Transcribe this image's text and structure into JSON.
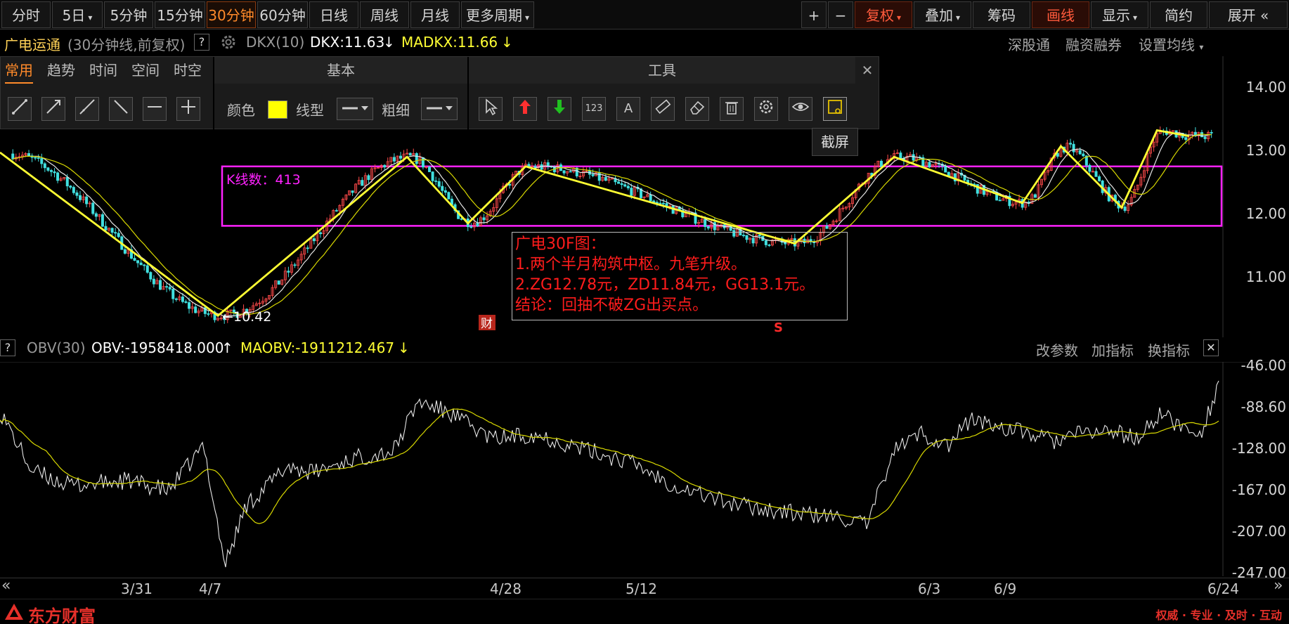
{
  "periods": [
    {
      "label": "分时"
    },
    {
      "label": "5日",
      "caret": "▾"
    },
    {
      "label": "5分钟"
    },
    {
      "label": "15分钟"
    },
    {
      "label": "30分钟",
      "active": true
    },
    {
      "label": "60分钟"
    },
    {
      "label": "日线"
    },
    {
      "label": "周线"
    },
    {
      "label": "月线"
    },
    {
      "label": "更多周期",
      "caret": "▾"
    }
  ],
  "right_toolbar": {
    "zoom_in": "+",
    "zoom_out": "−",
    "fuquan": "复权",
    "diejia": "叠加",
    "chouma": "筹码",
    "huaxian": "画线",
    "xianshi": "显示",
    "jianyue": "简约",
    "zhankai": "展开",
    "zhankai_arrow": "«"
  },
  "info": {
    "stock_name": "广电运通",
    "period_desc": "(30分钟线,前复权)",
    "help": "?",
    "indicator": "DKX(10)",
    "dkx": "DKX:11.63",
    "dkx_arrow": "↓",
    "madkx": "MADKX:11.66",
    "madkx_arrow": "↓",
    "links": [
      "深股通",
      "融资融券",
      "设置均线"
    ],
    "settings_caret": "▾"
  },
  "draw_panel": {
    "tabs": [
      "常用",
      "趋势",
      "时间",
      "空间",
      "时空"
    ],
    "active_tab": "常用",
    "basic_header": "基本",
    "tools_header": "工具",
    "close": "✕",
    "color_label": "颜色",
    "color_value": "#ffff00",
    "line_type_label": "线型",
    "thickness_label": "粗细",
    "tool_text_123": "123",
    "tool_text_A": "A",
    "tooltip": "截屏"
  },
  "main_axis": [
    "14.00",
    "13.00",
    "12.00",
    "11.00"
  ],
  "main_chart": {
    "kline_count": "K线数：413",
    "low_label": "←10.42",
    "cai_badge": "财",
    "s_badge": "S",
    "pivot_box": {
      "zg": 12.78,
      "zd": 11.84
    },
    "pen_points": [
      {
        "x_idx": 0,
        "price": 13.0
      },
      {
        "x_idx": 68,
        "price": 10.42
      },
      {
        "x_idx": 127,
        "price": 12.93
      },
      {
        "x_idx": 146,
        "price": 11.88
      },
      {
        "x_idx": 164,
        "price": 12.78
      },
      {
        "x_idx": 248,
        "price": 11.56
      },
      {
        "x_idx": 279,
        "price": 12.93
      },
      {
        "x_idx": 319,
        "price": 12.2
      },
      {
        "x_idx": 331,
        "price": 13.1
      },
      {
        "x_idx": 350,
        "price": 12.13
      },
      {
        "x_idx": 361,
        "price": 13.35
      },
      {
        "x_idx": 371,
        "price": 13.26
      }
    ]
  },
  "annotation": {
    "title": "广电30F图：",
    "line1": "1.两个半月构筑中枢。九笔升级。",
    "line2": "2.ZG12.78元，ZD11.84元，GG13.1元。",
    "line3": "结论：回抽不破ZG出买点。"
  },
  "obv_info": {
    "help": "?",
    "name": "OBV(30)",
    "obv": "OBV:-1958418.000",
    "obv_arrow": "↑",
    "maobv": "MAOBV:-1911212.467",
    "maobv_arrow": "↓",
    "links": [
      "改参数",
      "加指标",
      "换指标"
    ],
    "close": "✕"
  },
  "obv_axis": [
    "-46.00",
    "-88.60",
    "-128.00",
    "-167.00",
    "-207.00",
    "-247.00"
  ],
  "x_labels": [
    "3/31",
    "4/7",
    "4/28",
    "5/12",
    "6/3",
    "6/9",
    "6/24"
  ],
  "footer": {
    "brand": "东方财富",
    "slogan": "权威 · 专业 · 及时 · 互动"
  },
  "colors": {
    "accent_orange": "#ff8a2a",
    "pen_yellow": "#ffff33",
    "pivot_magenta": "#ff22ff",
    "annot_red": "#ff1c1c",
    "obv_white": "#e6e6e6",
    "maobv_yellow": "#d8d800"
  }
}
